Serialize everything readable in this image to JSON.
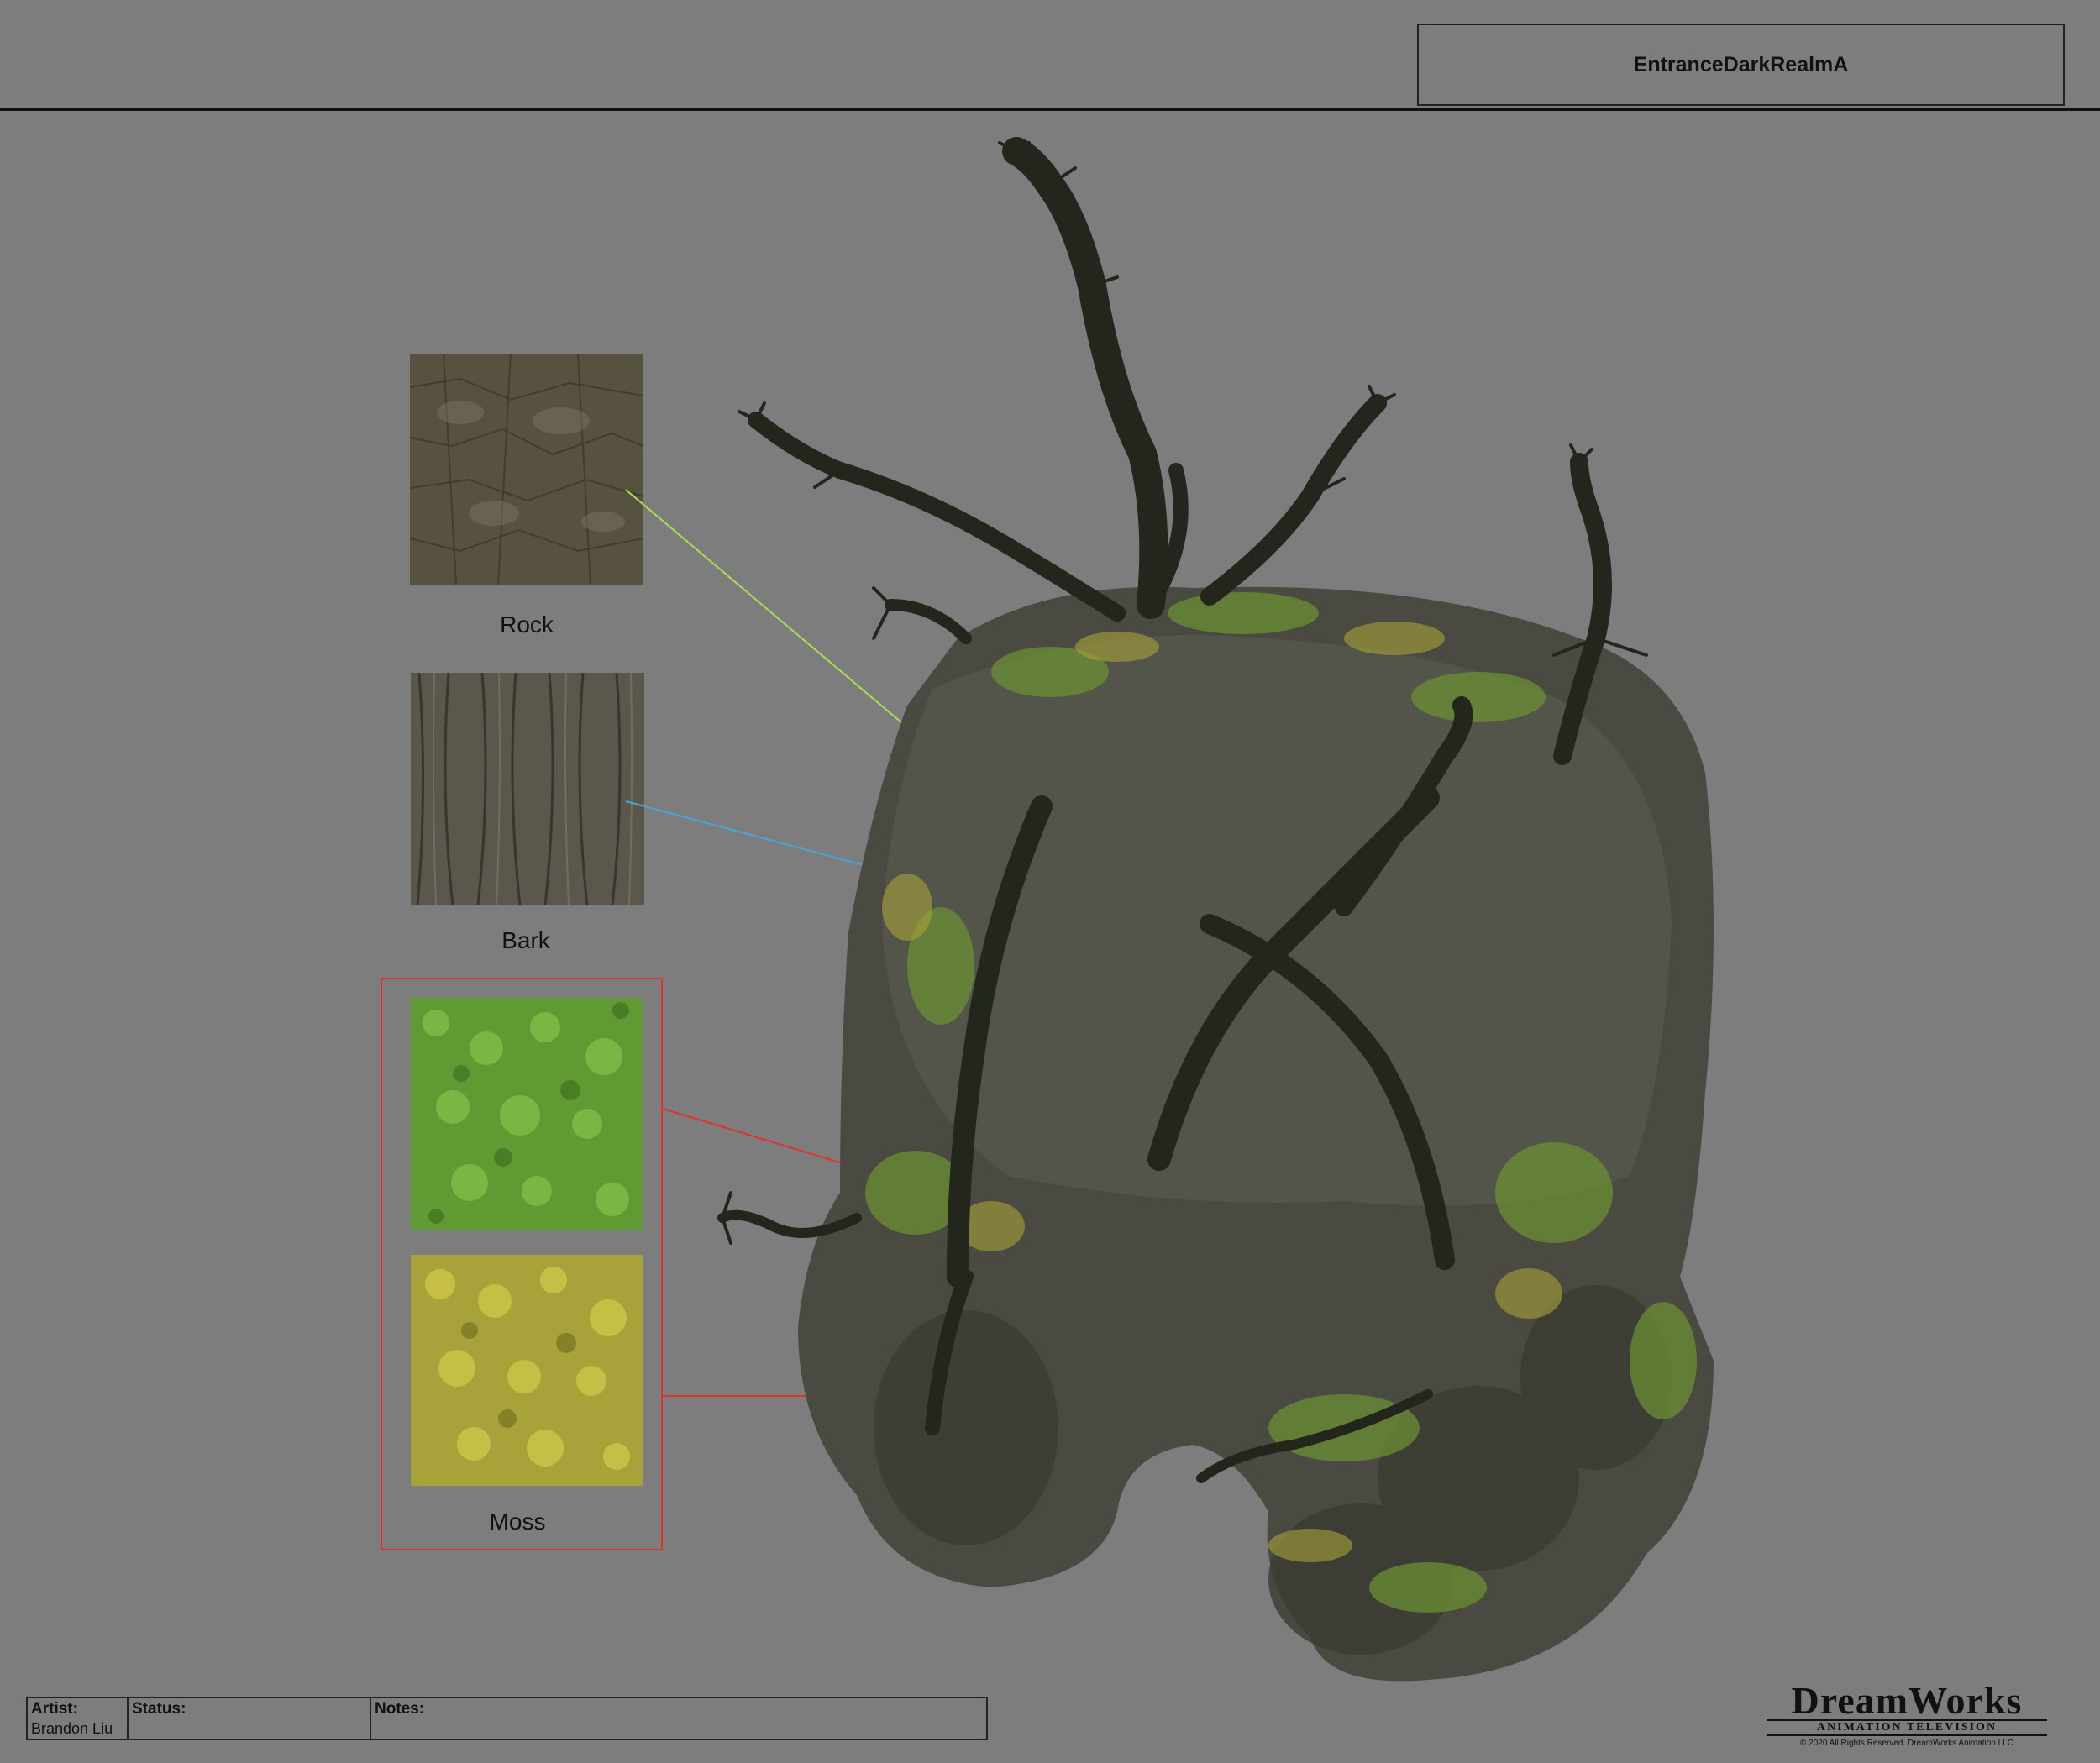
{
  "header": {
    "title": "EntranceDarkRealmA"
  },
  "swatches": [
    {
      "label": "Rock",
      "color": "#5b5647",
      "line_color": "#a6e050"
    },
    {
      "label": "Bark",
      "color": "#5c574c",
      "line_color": "#45a6d8"
    },
    {
      "label": "Moss",
      "colors": [
        "#6aa53a",
        "#b5b03a"
      ],
      "line_color": "#e0332c"
    }
  ],
  "footer": {
    "artist_label": "Artist:",
    "artist_value": "Brandon Liu",
    "status_label": "Status:",
    "status_value": "",
    "notes_label": "Notes:",
    "notes_value": ""
  },
  "logo": {
    "name": "DreamWorks",
    "subtitle": "ANIMATION TELEVISION",
    "copyright": "© 2020 All Rights Reserved. DreamWorks Animation LLC"
  }
}
